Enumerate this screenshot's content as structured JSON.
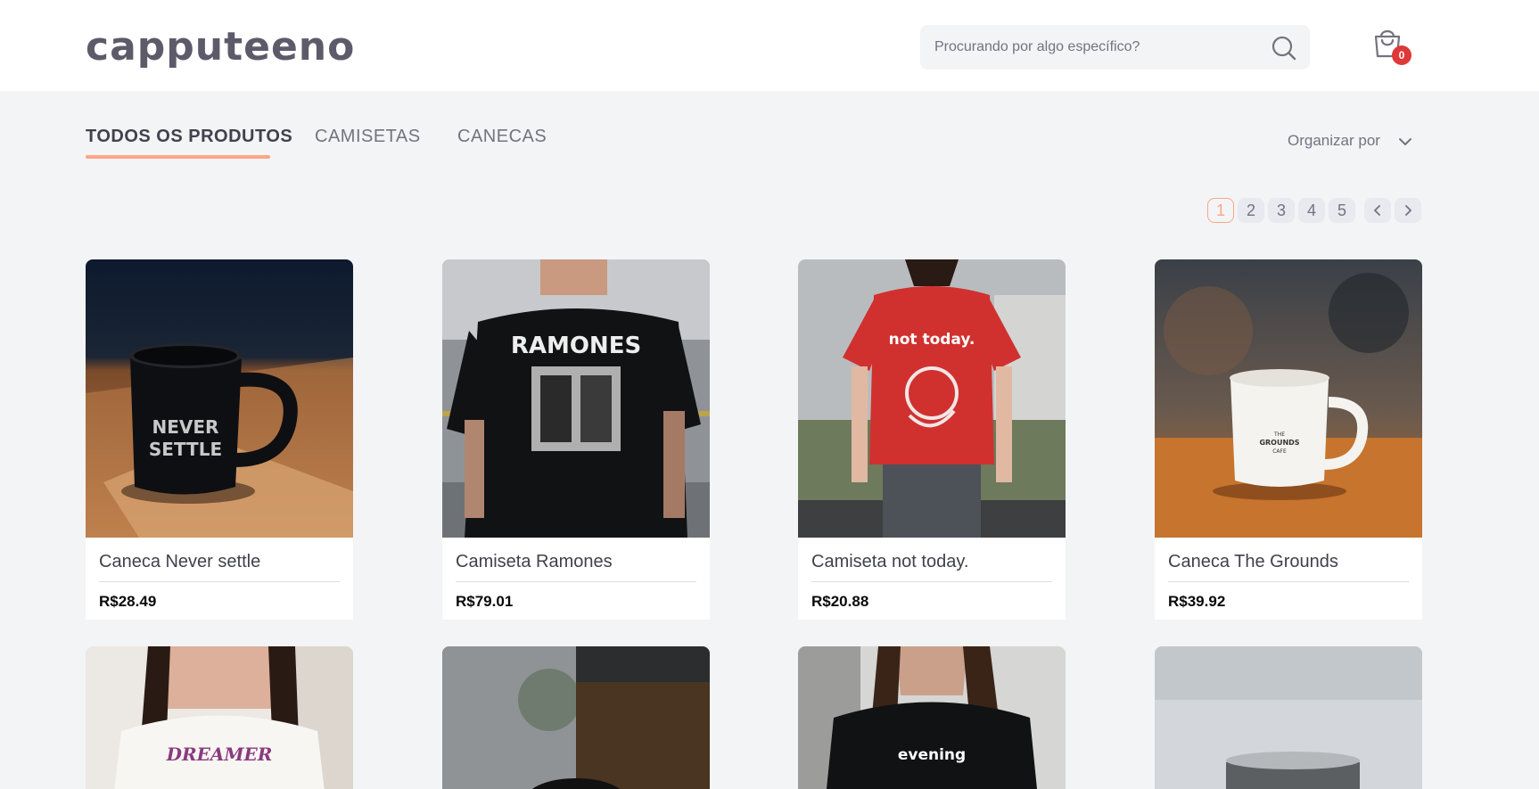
{
  "header": {
    "logo": "capputeeno",
    "search_placeholder": "Procurando por algo específico?",
    "cart_count": "0"
  },
  "tabs": [
    "TODOS OS PRODUTOS",
    "CAMISETAS",
    "CANECAS"
  ],
  "sort_label": "Organizar por",
  "pagination": [
    "1",
    "2",
    "3",
    "4",
    "5"
  ],
  "colors": {
    "accent": "#ffa585",
    "badge": "#de3838",
    "text": "#41414d"
  },
  "products": [
    {
      "name": "Caneca Never settle",
      "price": "R$28.49"
    },
    {
      "name": "Camiseta Ramones",
      "price": "R$79.01"
    },
    {
      "name": "Camiseta not today.",
      "price": "R$20.88"
    },
    {
      "name": "Caneca The Grounds",
      "price": "R$39.92"
    }
  ],
  "image_text": {
    "mug1": [
      "NEVER",
      "SETTLE"
    ],
    "shirt1": "RAMONES",
    "shirt2": "not today.",
    "mug2": [
      "THE",
      "GROUNDS",
      "CAFE"
    ],
    "shirt3": "DREAMER",
    "shirt4": "evening"
  }
}
